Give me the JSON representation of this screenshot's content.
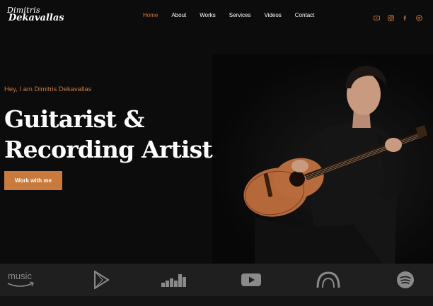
{
  "logo": {
    "line1": "Dimitris",
    "line2": "Dekavallas"
  },
  "nav": {
    "items": [
      {
        "label": "Home",
        "active": true
      },
      {
        "label": "About",
        "active": false
      },
      {
        "label": "Works",
        "active": false
      },
      {
        "label": "Services",
        "active": false
      },
      {
        "label": "Videos",
        "active": false
      },
      {
        "label": "Contact",
        "active": false
      }
    ]
  },
  "social_icons": [
    "youtube-icon",
    "instagram-icon",
    "facebook-icon",
    "spotify-icon"
  ],
  "hero": {
    "greeting": "Hey, I am Dimitris Dekavallas",
    "headline_line1": "Guitarist &",
    "headline_line2": "Recording Artist",
    "cta_label": "Work with me"
  },
  "platforms": {
    "amazon_music_text": "music",
    "icons": [
      "amazon-music-icon",
      "google-play-icon",
      "deezer-icon",
      "youtube-icon",
      "audiomack-icon",
      "spotify-icon"
    ]
  },
  "colors": {
    "accent": "#c97b3d",
    "background": "#0c0c0c",
    "platform_bar": "#1f1f1f",
    "platform_icon": "#8a8a8a"
  }
}
